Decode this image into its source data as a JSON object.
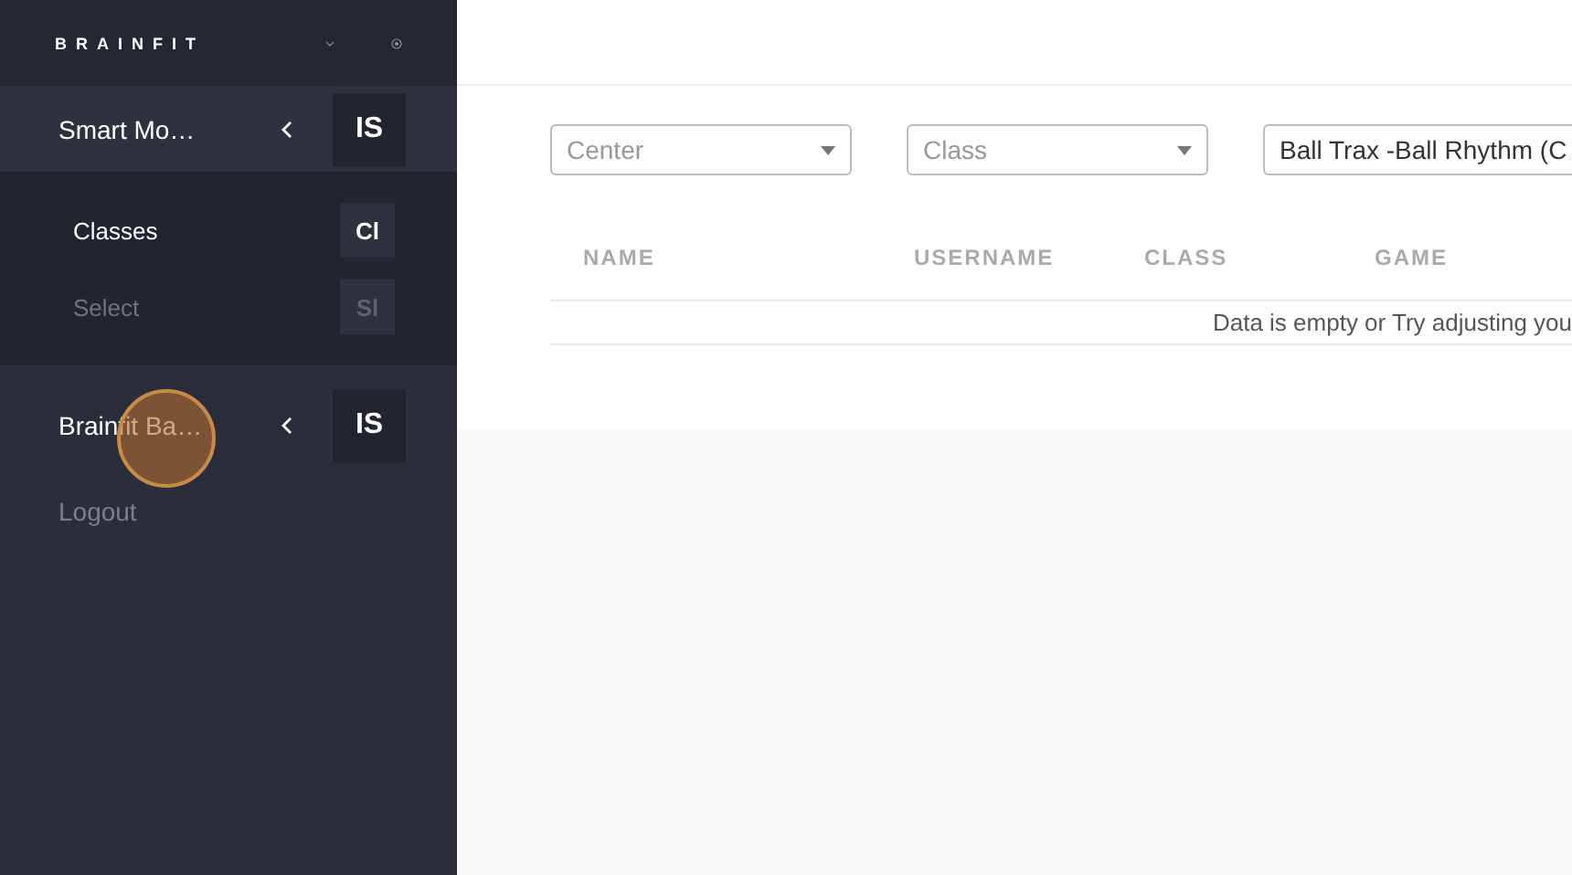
{
  "sidebar": {
    "logo": "BRAINFIT",
    "groups": [
      {
        "label": "Smart Mo…",
        "avatar": "IS",
        "children": [
          {
            "label": "Classes",
            "avatar": "Cl",
            "selected": true
          },
          {
            "label": "Select",
            "avatar": "Sl",
            "selected": false
          }
        ]
      },
      {
        "label": "Brainfit Ba…",
        "avatar": "IS"
      }
    ],
    "logout": "Logout"
  },
  "filters": [
    {
      "placeholder": "Center"
    },
    {
      "placeholder": "Class"
    },
    {
      "value": "Ball Trax -Ball Rhythm (C"
    }
  ],
  "table": {
    "columns": [
      "NAME",
      "USERNAME",
      "CLASS",
      "GAME"
    ],
    "empty_text": "Data is empty or Try adjusting you"
  }
}
